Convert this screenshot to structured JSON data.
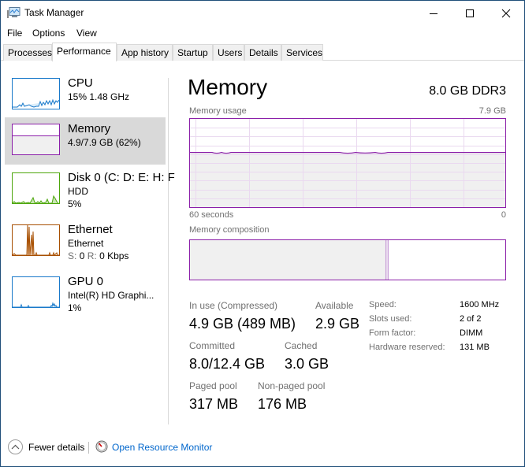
{
  "window": {
    "title": "Task Manager",
    "controls": {
      "minimize": "minimize",
      "maximize": "maximize",
      "close": "close"
    }
  },
  "menu": [
    "File",
    "Options",
    "View"
  ],
  "tabs": [
    {
      "label": "Processes",
      "active": false
    },
    {
      "label": "Performance",
      "active": true
    },
    {
      "label": "App history",
      "active": false
    },
    {
      "label": "Startup",
      "active": false
    },
    {
      "label": "Users",
      "active": false
    },
    {
      "label": "Details",
      "active": false
    },
    {
      "label": "Services",
      "active": false
    }
  ],
  "sidebar": {
    "items": [
      {
        "title": "CPU",
        "line1": "15% 1.48 GHz",
        "line2": "",
        "color": "#1979ca",
        "selected": false
      },
      {
        "title": "Memory",
        "line1": "4.9/7.9 GB (62%)",
        "line2": "",
        "color": "#8b1fa9",
        "selected": true
      },
      {
        "title": "Disk 0 (C: D: E: H: F",
        "line1": "HDD",
        "line2": "5%",
        "color": "#4da60c",
        "selected": false
      },
      {
        "title": "Ethernet",
        "line1": "Ethernet",
        "line2_send_label": "S:",
        "line2_send_value": "0",
        "line2_recv_label": "R:",
        "line2_recv_value": "0 Kbps",
        "color": "#a74f01",
        "selected": false
      },
      {
        "title": "GPU 0",
        "line1": "Intel(R) HD Graphi...",
        "line2": "1%",
        "color": "#1979ca",
        "selected": false
      }
    ]
  },
  "main": {
    "title": "Memory",
    "spec": "8.0 GB DDR3",
    "usage_label": "Memory usage",
    "usage_max": "7.9 GB",
    "axis_left": "60 seconds",
    "axis_right": "0",
    "composition_label": "Memory composition",
    "composition": {
      "in_use_fraction": 0.62,
      "modified_fraction": 0.01,
      "accent": "#8b1fa9"
    },
    "usage_fraction": 0.62,
    "stats": {
      "in_use_label": "In use (Compressed)",
      "in_use_value": "4.9 GB (489 MB)",
      "available_label": "Available",
      "available_value": "2.9 GB",
      "committed_label": "Committed",
      "committed_value": "8.0/12.4 GB",
      "cached_label": "Cached",
      "cached_value": "3.0 GB",
      "paged_label": "Paged pool",
      "paged_value": "317 MB",
      "nonpaged_label": "Non-paged pool",
      "nonpaged_value": "176 MB"
    },
    "specs": [
      {
        "key": "Speed:",
        "value": "1600 MHz"
      },
      {
        "key": "Slots used:",
        "value": "2 of 2"
      },
      {
        "key": "Form factor:",
        "value": "DIMM"
      },
      {
        "key": "Hardware reserved:",
        "value": "131 MB"
      }
    ]
  },
  "footer": {
    "fewer_details": "Fewer details",
    "resource_monitor": "Open Resource Monitor"
  }
}
